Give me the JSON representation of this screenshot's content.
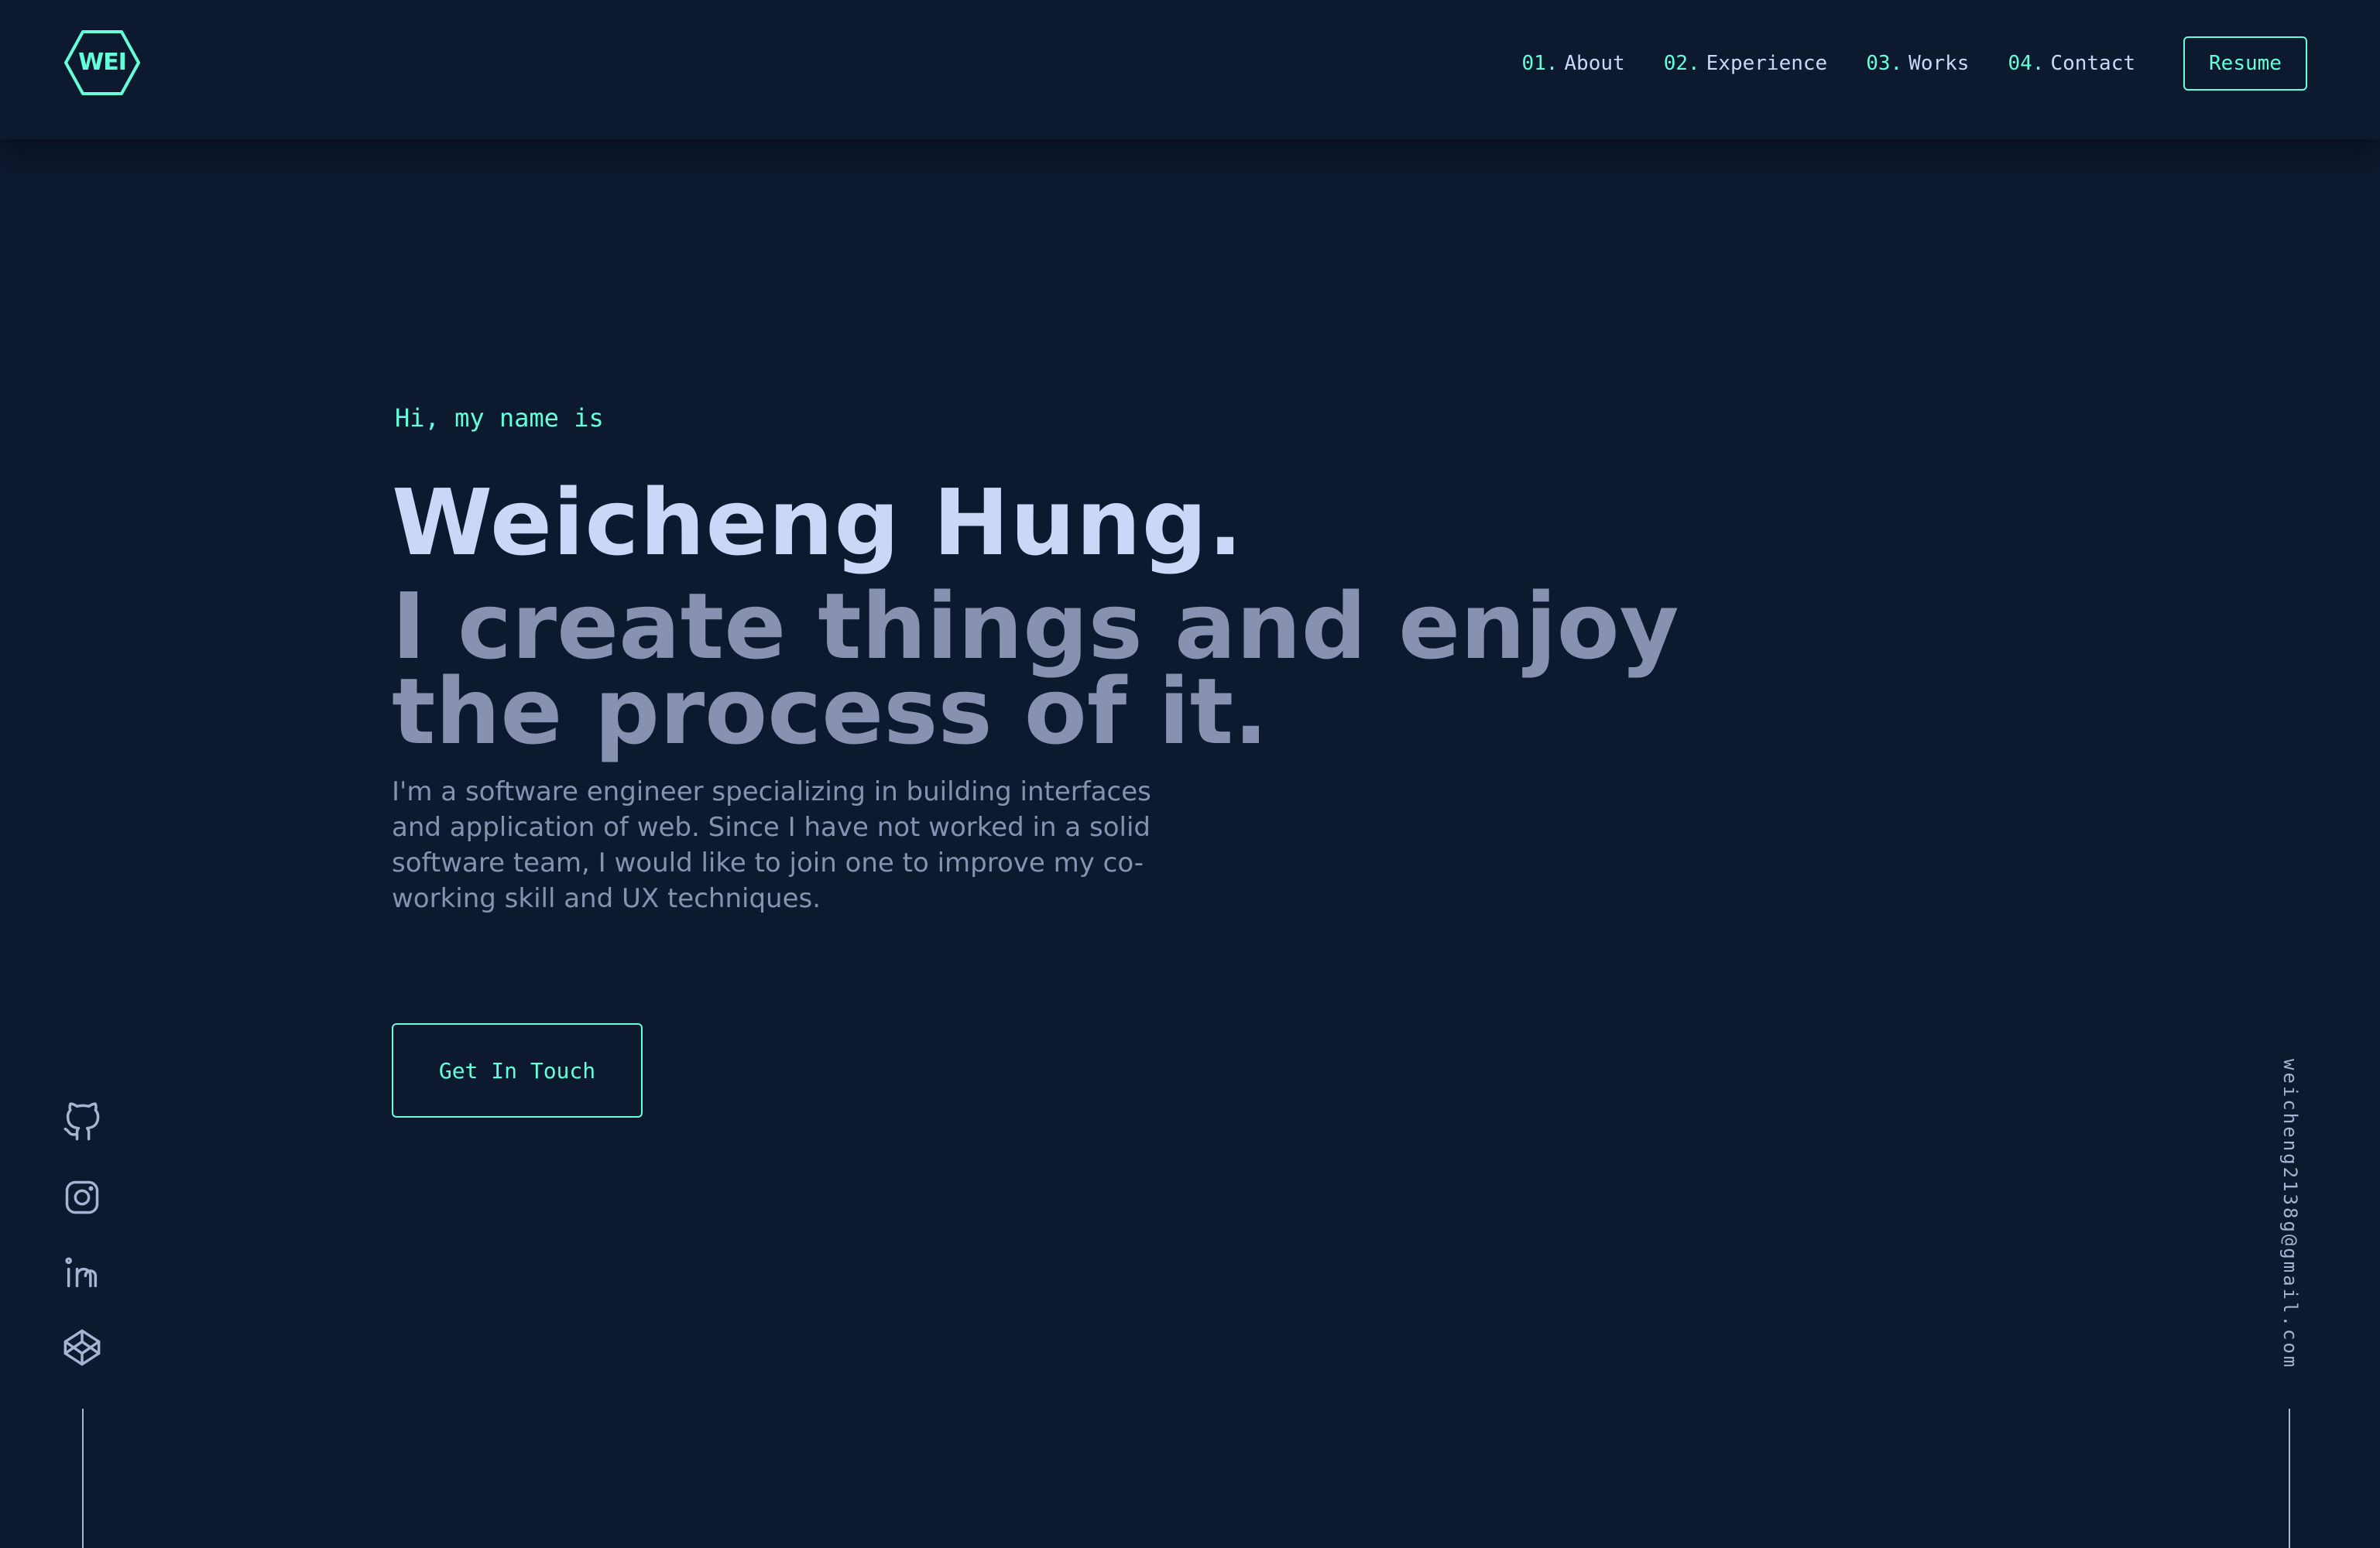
{
  "header": {
    "logo_text": "WEI",
    "nav": [
      {
        "number": "01.",
        "label": "About"
      },
      {
        "number": "02.",
        "label": "Experience"
      },
      {
        "number": "03.",
        "label": "Works"
      },
      {
        "number": "04.",
        "label": "Contact"
      }
    ],
    "resume_label": "Resume"
  },
  "hero": {
    "greeting": "Hi, my name is",
    "name": "Weicheng Hung.",
    "tagline": "I create things and enjoy the process of it.",
    "bio": "I'm a software engineer specializing in building interfaces and application of web. Since I have not worked in a solid software team, I would like to join one to improve my co-working skill and UX techniques.",
    "cta_label": "Get In Touch"
  },
  "social": [
    {
      "icon": "github-icon"
    },
    {
      "icon": "instagram-icon"
    },
    {
      "icon": "linkedin-icon"
    },
    {
      "icon": "codepen-icon"
    }
  ],
  "email": "weicheng2138g@gmail.com",
  "colors": {
    "background": "#0d192f",
    "accent": "#64ffda",
    "heading": "#ccd6f6",
    "body_text": "#8892b0"
  }
}
